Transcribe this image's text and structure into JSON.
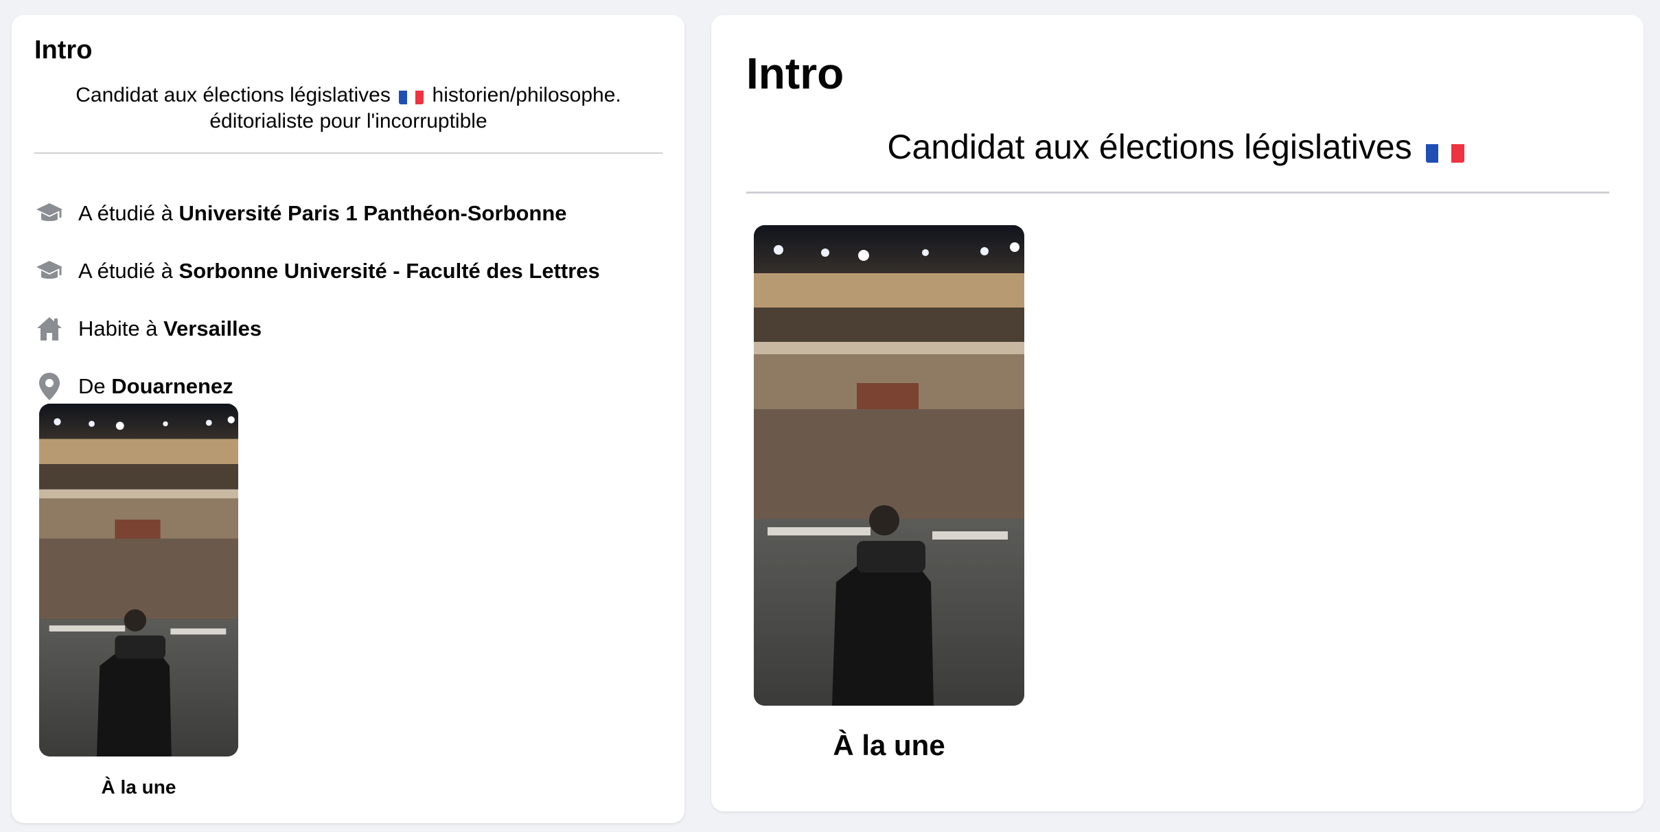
{
  "left_panel": {
    "title": "Intro",
    "bio_line1_before_flag": "Candidat aux élections législatives",
    "bio_line1_after_flag": "historien/philosophe.",
    "bio_line2": "éditorialiste pour l'incorruptible",
    "details": [
      {
        "icon": "education-cap-icon",
        "prefix": "A étudié à ",
        "value": "Université Paris 1 Panthéon-Sorbonne"
      },
      {
        "icon": "education-cap-icon",
        "prefix": "A étudié à ",
        "value": "Sorbonne Université - Faculté des Lettres"
      },
      {
        "icon": "home-icon",
        "prefix": "Habite à ",
        "value": "Versailles"
      },
      {
        "icon": "location-pin-icon",
        "prefix": "De ",
        "value": "Douarnenez"
      }
    ],
    "featured_caption": "À la une"
  },
  "right_panel": {
    "title": "Intro",
    "bio": "Candidat aux élections législatives",
    "featured_caption": "À la une"
  },
  "colors": {
    "background": "#f0f2f5",
    "card": "#ffffff",
    "text": "#050505",
    "icon": "#8a8d91",
    "divider": "#ced0d4",
    "flag_blue": "#1f4fb4",
    "flag_red": "#ef3340"
  }
}
